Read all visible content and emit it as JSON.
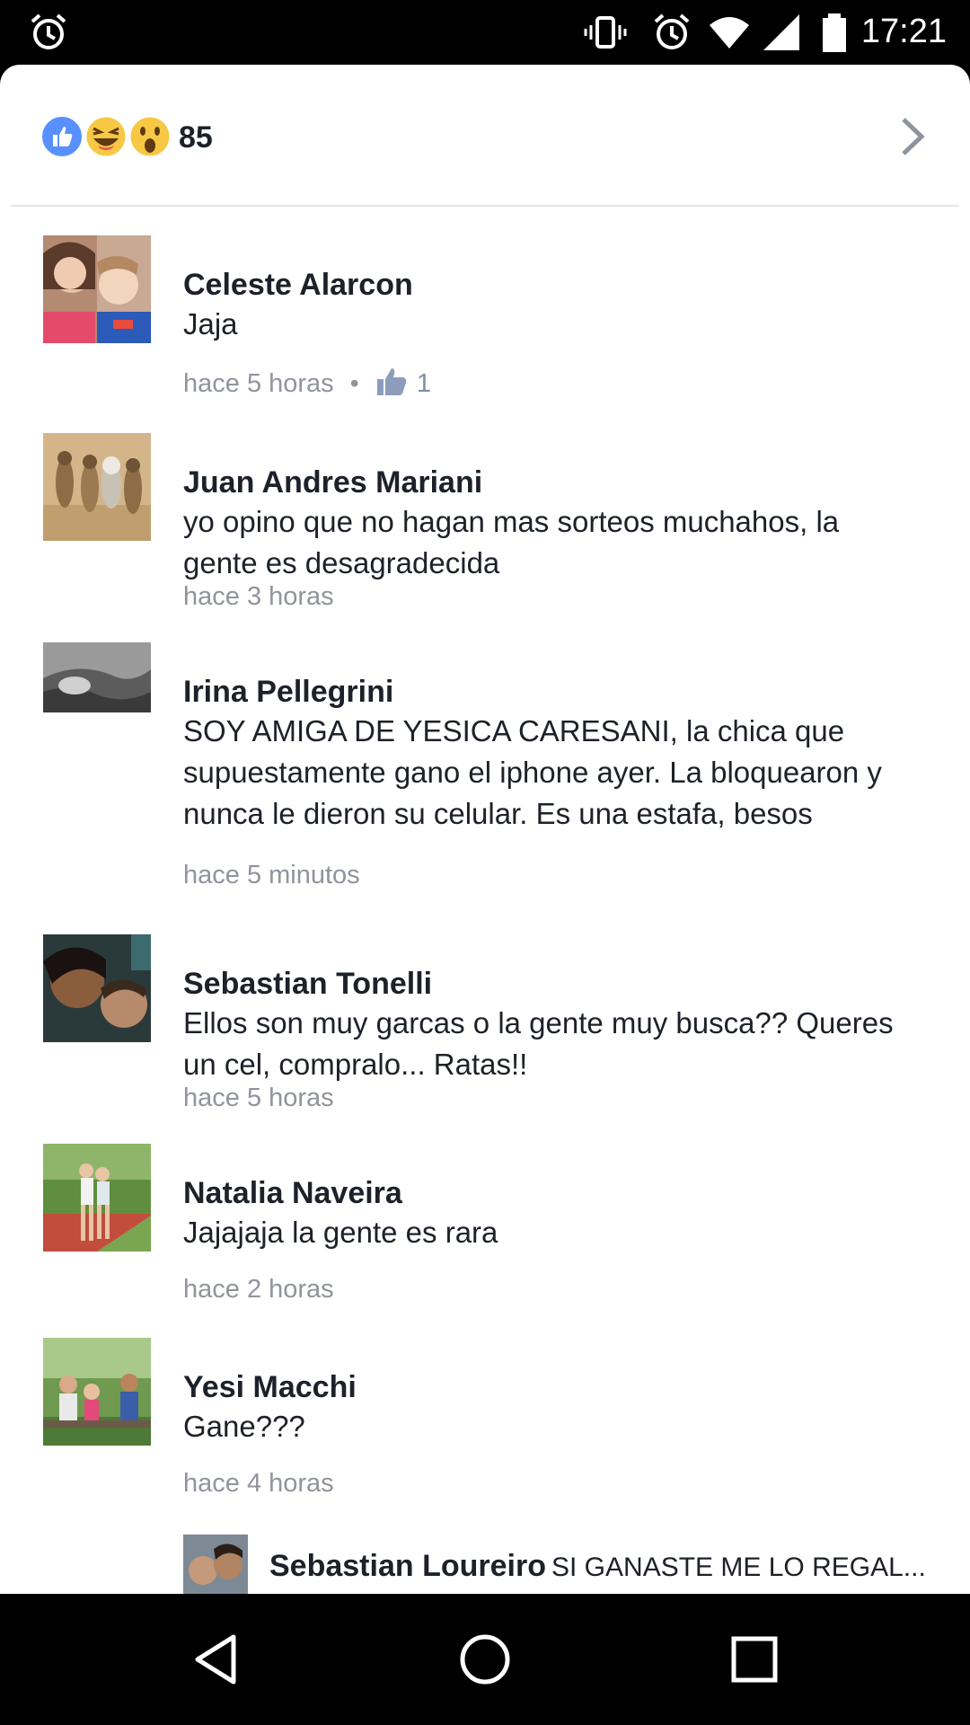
{
  "status_bar": {
    "time": "17:21",
    "icons": [
      "alarm-icon",
      "vibrate-icon",
      "alarm-icon",
      "wifi-icon",
      "signal-icon",
      "battery-icon"
    ]
  },
  "reactions": {
    "types": [
      "like",
      "haha",
      "wow"
    ],
    "count": "85"
  },
  "comments": [
    {
      "name": "Celeste Alarcon",
      "text": "Jaja",
      "time": "hace 5 horas",
      "likes": "1"
    },
    {
      "name": "Juan Andres Mariani",
      "text": "yo opino que no hagan mas sorteos muchahos, la gente es desagradecida",
      "time": "hace 3 horas"
    },
    {
      "name": "Irina Pellegrini",
      "text": "SOY AMIGA DE YESICA CARESANI, la chica que supuestamente gano el iphone ayer. La bloquearon y nunca le dieron su celular. Es una estafa, besos",
      "time": "hace 5 minutos"
    },
    {
      "name": "Sebastian Tonelli",
      "text": "Ellos son muy garcas o la gente muy busca?? Queres un cel, compralo... Ratas!!",
      "time": "hace 5 horas"
    },
    {
      "name": "Natalia Naveira",
      "text": "Jajajaja la gente es rara",
      "time": "hace 2 horas"
    },
    {
      "name": "Yesi Macchi",
      "text": "Gane???",
      "time": "hace 4 horas"
    }
  ],
  "reply": {
    "name": "Sebastian Loureiro",
    "text": "SI GANASTE ME LO REGAL..."
  },
  "colors": {
    "like_blue": "#5890ff",
    "emoji_yellow": "#f7c844",
    "meta_gray": "#90949c",
    "text_dark": "#1d2129"
  }
}
